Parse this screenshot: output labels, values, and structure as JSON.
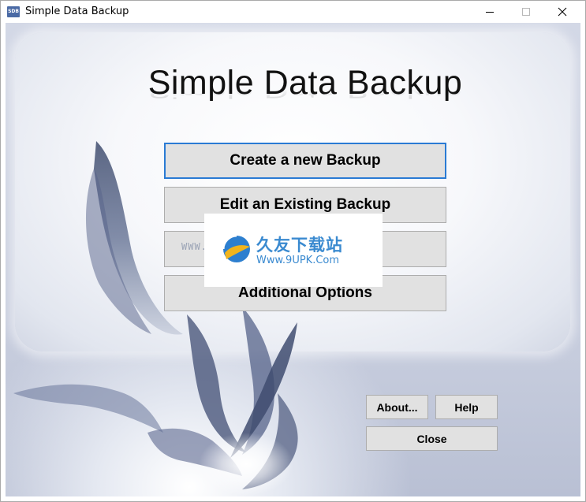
{
  "window": {
    "title": "Simple Data Backup",
    "icon_text": "SDB",
    "controls": [
      "minimize-icon",
      "maximize-icon",
      "close-icon"
    ]
  },
  "app": {
    "title": "Simple Data Backup"
  },
  "menu": {
    "create_label": "Create a new Backup",
    "edit_label": "Edit an Existing Backup",
    "options_label": "Additional Options"
  },
  "footer": {
    "about_label": "About...",
    "help_label": "Help",
    "close_label": "Close"
  },
  "watermark": {
    "brand_cn": "久友下载站",
    "url": "Www.9UPK.Com",
    "faint_left": "WWW.9UPK.COM",
    "faint_right": "W"
  },
  "colors": {
    "focus_border": "#2a7bd4",
    "button_face": "#e1e1e1",
    "watermark_blue": "#3a8ad0"
  }
}
